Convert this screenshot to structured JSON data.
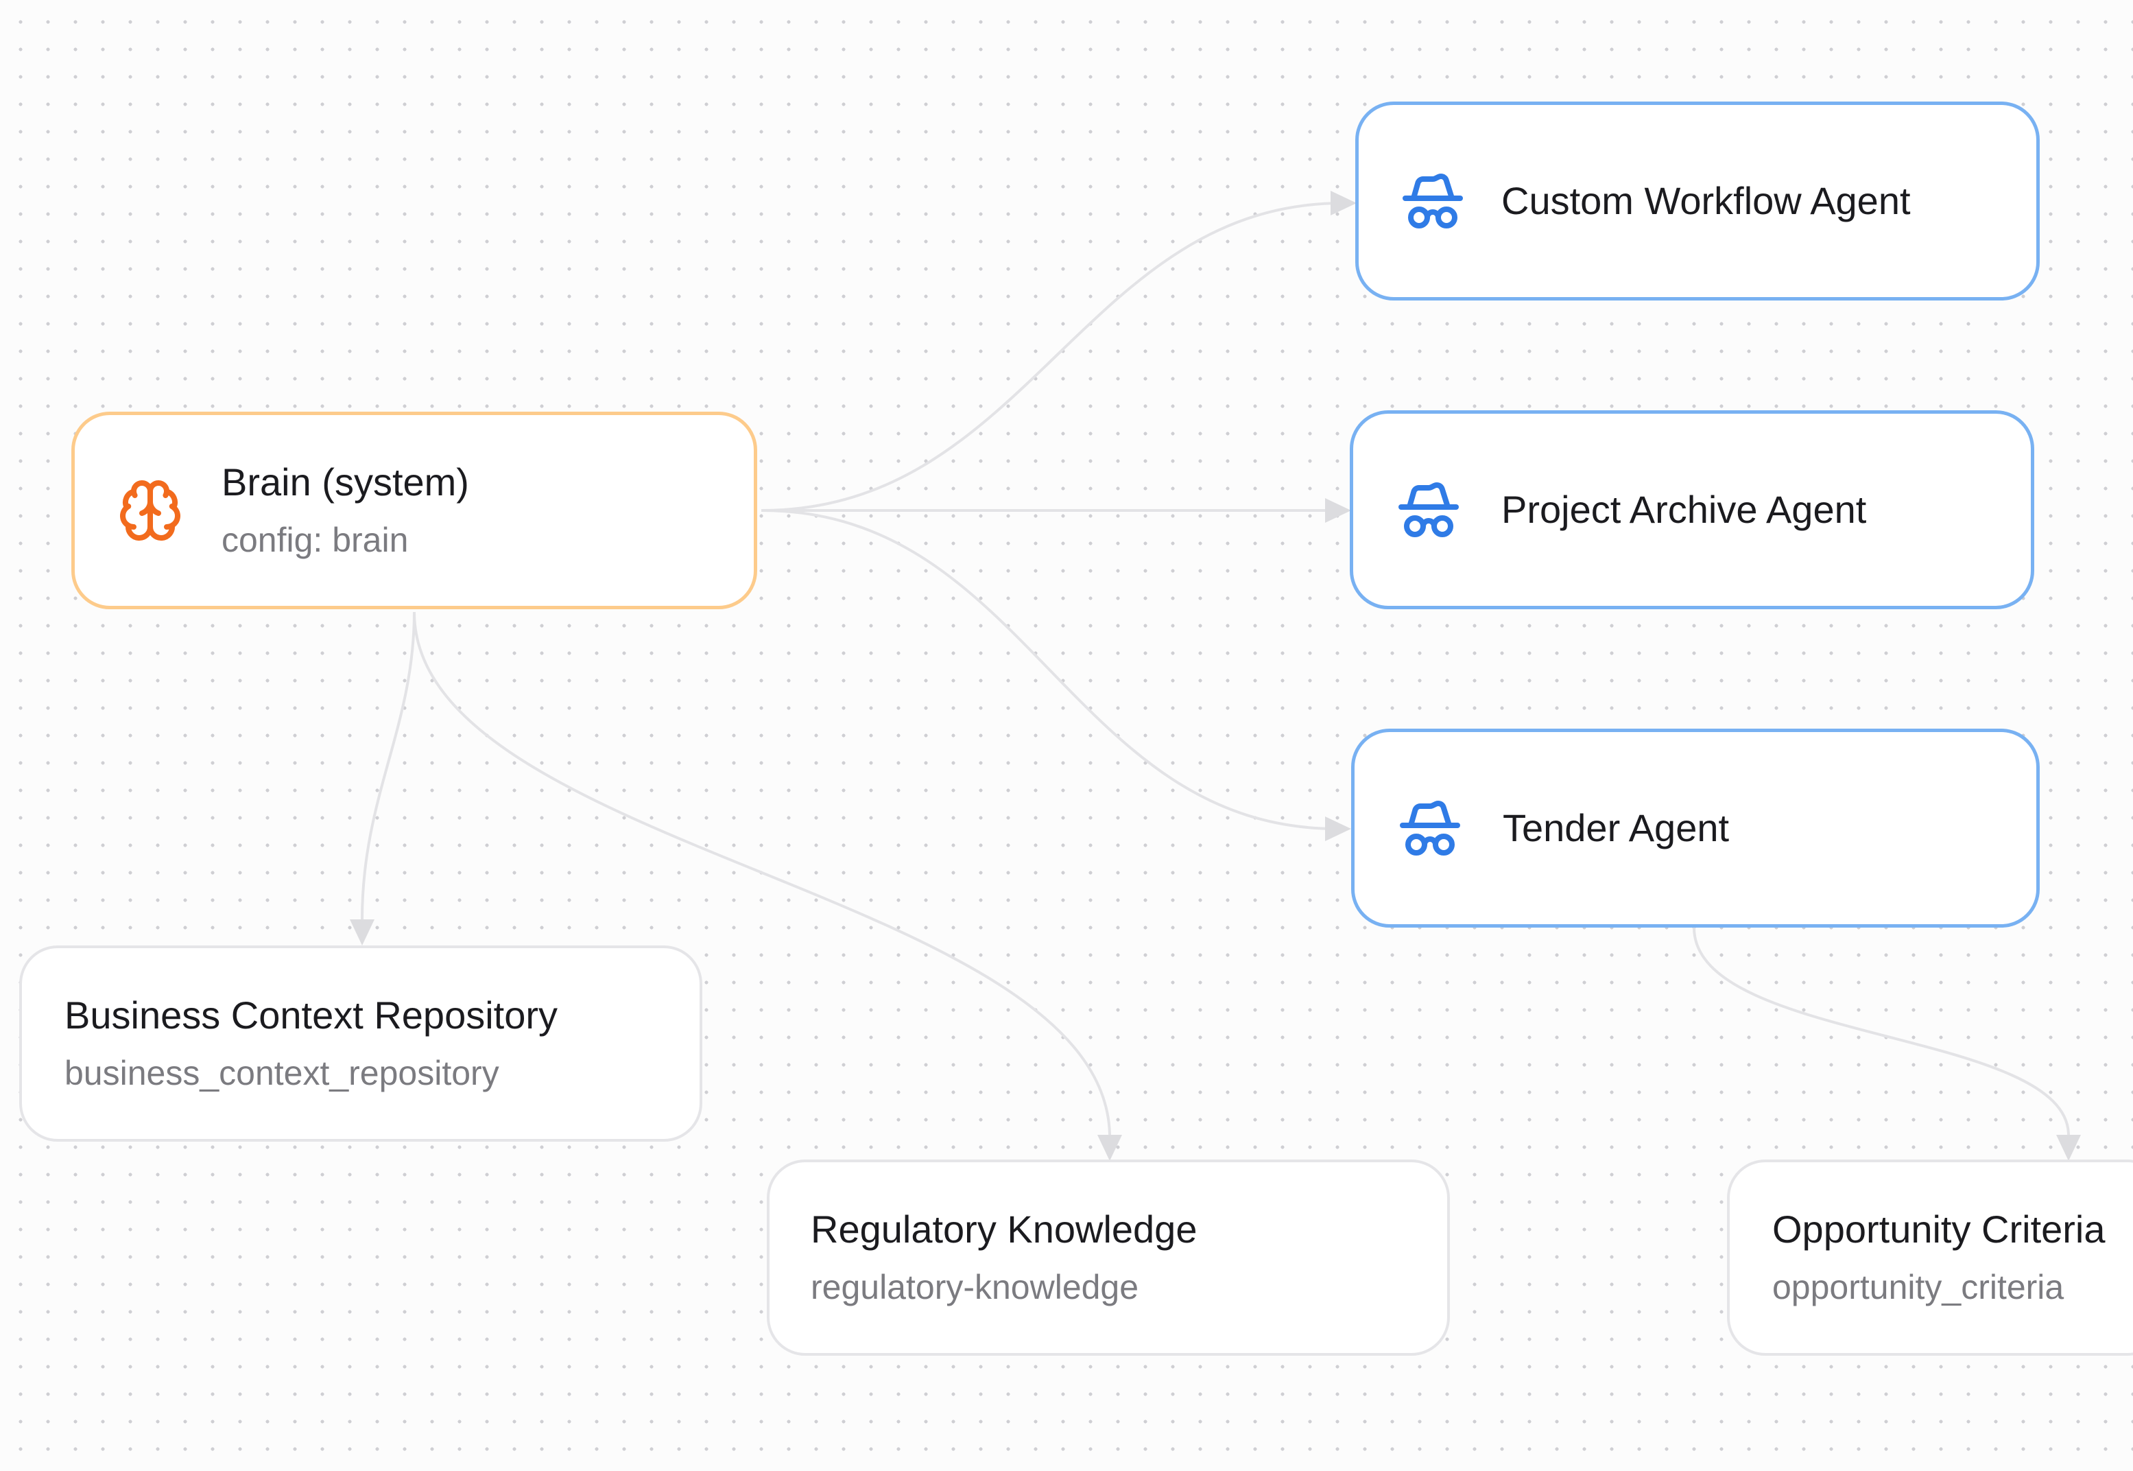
{
  "nodes": {
    "brain": {
      "title": "Brain (system)",
      "subtitle": "config: brain",
      "icon": "brain-icon",
      "accent": "#f26b1d",
      "border": "#fdcb8b"
    },
    "custom_workflow": {
      "title": "Custom Workflow Agent",
      "icon": "agent-icon",
      "accent": "#2f7be6",
      "border": "#78b1f2"
    },
    "project_archive": {
      "title": "Project Archive Agent",
      "icon": "agent-icon",
      "accent": "#2f7be6",
      "border": "#78b1f2"
    },
    "tender": {
      "title": "Tender Agent",
      "icon": "agent-icon",
      "accent": "#2f7be6",
      "border": "#78b1f2"
    },
    "business_context": {
      "title": "Business Context Repository",
      "subtitle": "business_context_repository"
    },
    "regulatory": {
      "title": "Regulatory Knowledge",
      "subtitle": "regulatory-knowledge"
    },
    "opportunity": {
      "title": "Opportunity Criteria",
      "subtitle": "opportunity_criteria"
    }
  },
  "edges": [
    {
      "from": "brain",
      "to": "custom_workflow"
    },
    {
      "from": "brain",
      "to": "project_archive"
    },
    {
      "from": "brain",
      "to": "tender"
    },
    {
      "from": "brain",
      "to": "business_context"
    },
    {
      "from": "brain",
      "to": "regulatory"
    },
    {
      "from": "tender",
      "to": "opportunity"
    }
  ]
}
